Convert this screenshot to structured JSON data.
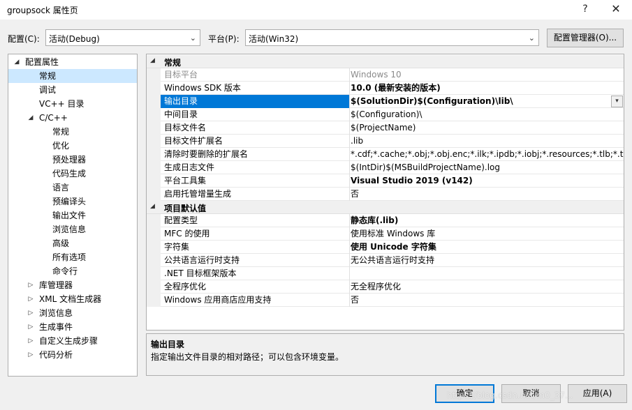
{
  "window": {
    "title": "groupsock 属性页",
    "help_glyph": "?",
    "close_glyph": "✕"
  },
  "config_bar": {
    "config_label": "配置(C):",
    "config_value": "活动(Debug)",
    "platform_label": "平台(P):",
    "platform_value": "活动(Win32)",
    "manager_button": "配置管理器(O)..."
  },
  "tree": {
    "items": [
      {
        "label": "配置属性",
        "expander": "◢"
      },
      {
        "label": "常规"
      },
      {
        "label": "调试"
      },
      {
        "label": "VC++ 目录"
      },
      {
        "label": "C/C++",
        "expander": "◢"
      },
      {
        "label": "常规"
      },
      {
        "label": "优化"
      },
      {
        "label": "预处理器"
      },
      {
        "label": "代码生成"
      },
      {
        "label": "语言"
      },
      {
        "label": "预编译头"
      },
      {
        "label": "输出文件"
      },
      {
        "label": "浏览信息"
      },
      {
        "label": "高级"
      },
      {
        "label": "所有选项"
      },
      {
        "label": "命令行"
      },
      {
        "label": "库管理器",
        "expander": "▷"
      },
      {
        "label": "XML 文档生成器",
        "expander": "▷"
      },
      {
        "label": "浏览信息",
        "expander": "▷"
      },
      {
        "label": "生成事件",
        "expander": "▷"
      },
      {
        "label": "自定义生成步骤",
        "expander": "▷"
      },
      {
        "label": "代码分析",
        "expander": "▷"
      }
    ]
  },
  "grid": {
    "categories": [
      {
        "label": "常规",
        "expander": "◢"
      },
      {
        "label": "项目默认值",
        "expander": "◢"
      }
    ],
    "general": [
      {
        "name": "目标平台",
        "value": "Windows 10"
      },
      {
        "name": "Windows SDK 版本",
        "value": "10.0 (最新安装的版本)"
      },
      {
        "name": "输出目录",
        "value": "$(SolutionDir)$(Configuration)\\lib\\"
      },
      {
        "name": "中间目录",
        "value": "$(Configuration)\\"
      },
      {
        "name": "目标文件名",
        "value": "$(ProjectName)"
      },
      {
        "name": "目标文件扩展名",
        "value": ".lib"
      },
      {
        "name": "清除时要删除的扩展名",
        "value": "*.cdf;*.cache;*.obj;*.obj.enc;*.ilk;*.ipdb;*.iobj;*.resources;*.tlb;*.tli;*.tlh;"
      },
      {
        "name": "生成日志文件",
        "value": "$(IntDir)$(MSBuildProjectName).log"
      },
      {
        "name": "平台工具集",
        "value": "Visual Studio 2019 (v142)"
      },
      {
        "name": "启用托管增量生成",
        "value": "否"
      }
    ],
    "defaults": [
      {
        "name": "配置类型",
        "value": "静态库(.lib)"
      },
      {
        "name": "MFC 的使用",
        "value": "使用标准 Windows 库"
      },
      {
        "name": "字符集",
        "value": "使用 Unicode 字符集"
      },
      {
        "name": "公共语言运行时支持",
        "value": "无公共语言运行时支持"
      },
      {
        "name": ".NET 目标框架版本",
        "value": ""
      },
      {
        "name": "全程序优化",
        "value": "无全程序优化"
      },
      {
        "name": "Windows 应用商店应用支持",
        "value": "否"
      }
    ],
    "dropdown_glyph": "▾"
  },
  "description": {
    "title": "输出目录",
    "text": "指定输出文件目录的相对路径；可以包含环境变量。"
  },
  "footer": {
    "ok": "确定",
    "cancel": "取消",
    "apply": "应用(A)"
  },
  "watermark": "https://blog.csdn.net/m0_37..."
}
